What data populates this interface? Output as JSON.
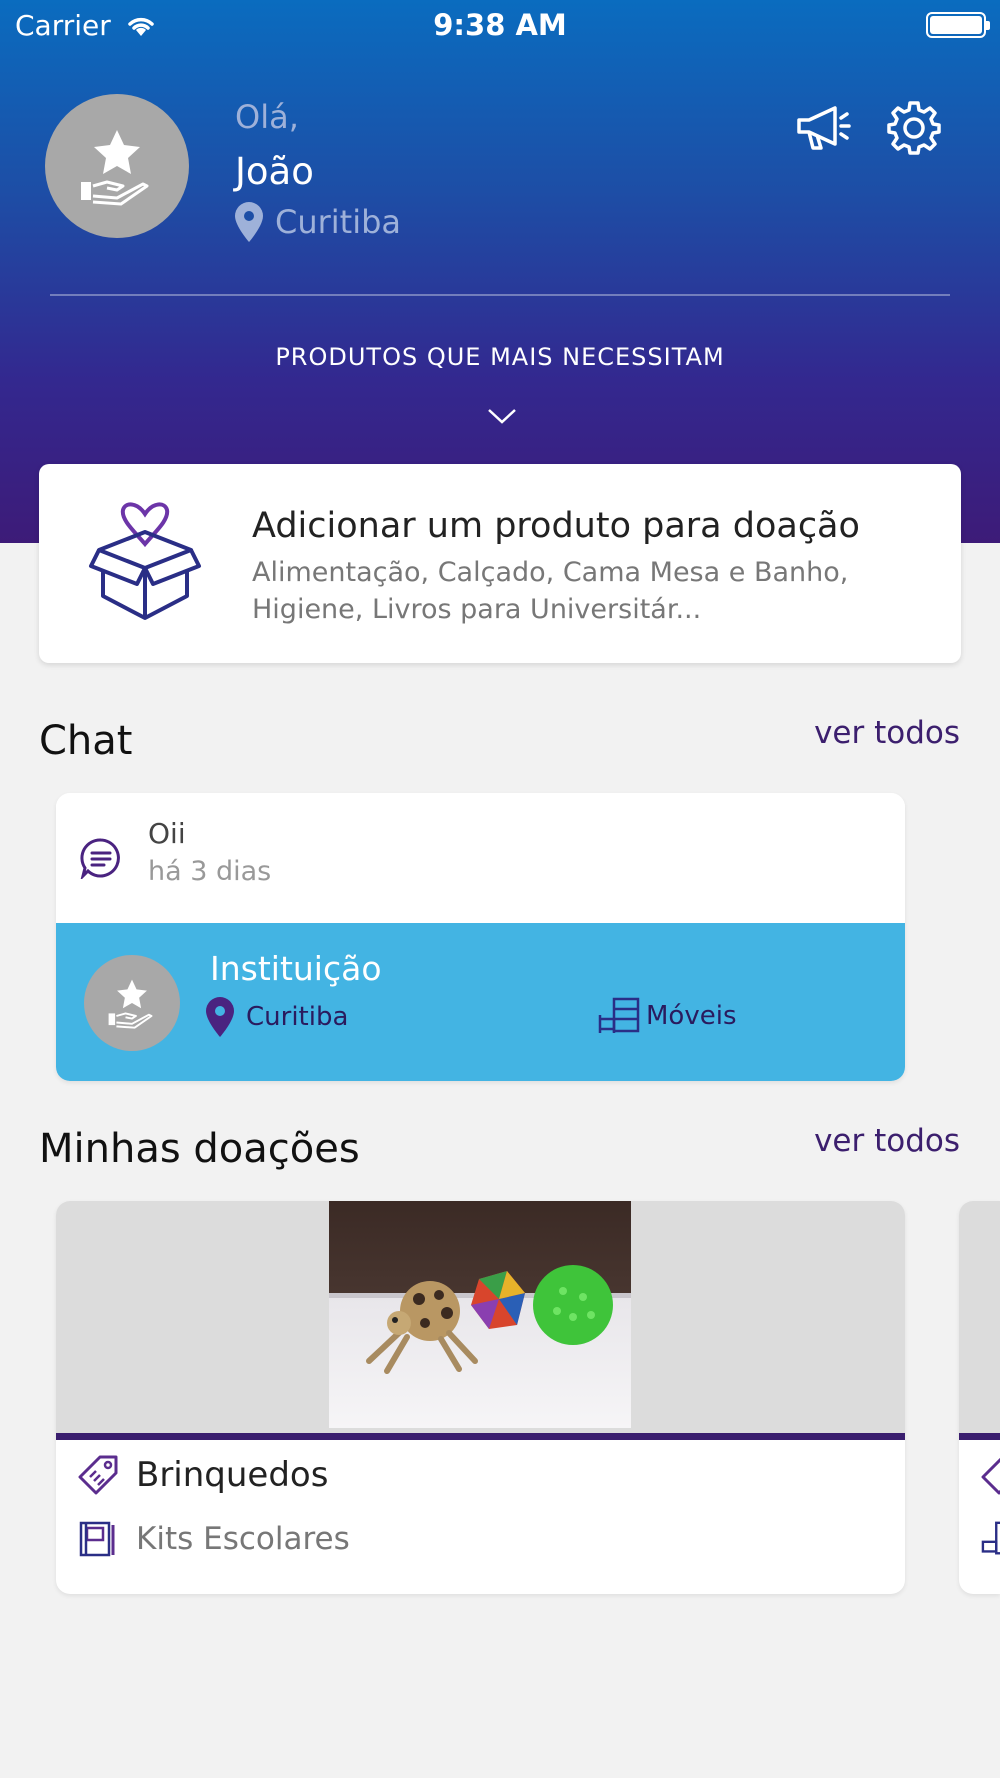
{
  "status_bar": {
    "carrier": "Carrier",
    "time": "9:38 AM"
  },
  "profile": {
    "greeting": "Olá,",
    "name": "João",
    "city": "Curitiba"
  },
  "needs": {
    "title": "PRODUTOS QUE MAIS NECESSITAM"
  },
  "add_product": {
    "title": "Adicionar um produto para doação",
    "subtitle": "Alimentação, Calçado, Cama Mesa e Banho, Higiene, Livros para Universitár..."
  },
  "chat": {
    "title": "Chat",
    "see_all": "ver todos",
    "last_message": "Oii",
    "time_ago": "há 3 dias",
    "institution": {
      "name": "Instituição",
      "city": "Curitiba",
      "category": "Móveis"
    }
  },
  "donations": {
    "title": "Minhas doações",
    "see_all": "ver todos",
    "items": [
      {
        "category": "Brinquedos",
        "subcategory": "Kits Escolares"
      }
    ]
  },
  "colors": {
    "accent": "#3c1f6e",
    "chat_highlight": "#43b4e3",
    "header_top": "#0a6cbf",
    "header_bottom": "#3d1b78"
  }
}
